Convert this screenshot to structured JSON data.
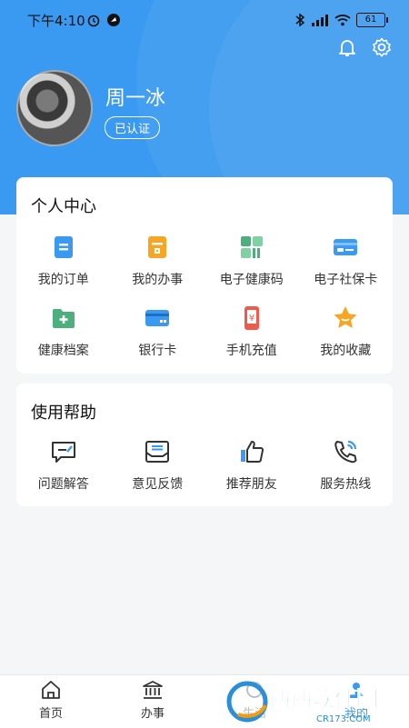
{
  "status_bar": {
    "time": "下午4:10",
    "battery": "61"
  },
  "profile": {
    "name": "周一冰",
    "badge": "已认证"
  },
  "personal_center": {
    "title": "个人中心",
    "items": [
      {
        "label": "我的订单",
        "icon": "order-icon",
        "color": "#3a99f0"
      },
      {
        "label": "我的办事",
        "icon": "affairs-icon",
        "color": "#f5a623"
      },
      {
        "label": "电子健康码",
        "icon": "health-code-icon",
        "color": "#4caf7d"
      },
      {
        "label": "电子社保卡",
        "icon": "social-card-icon",
        "color": "#3a99f0"
      },
      {
        "label": "健康档案",
        "icon": "health-record-icon",
        "color": "#4caf7d"
      },
      {
        "label": "银行卡",
        "icon": "bank-card-icon",
        "color": "#3a99f0"
      },
      {
        "label": "手机充值",
        "icon": "phone-recharge-icon",
        "color": "#f05a4a"
      },
      {
        "label": "我的收藏",
        "icon": "favorite-icon",
        "color": "#f5a623"
      }
    ]
  },
  "help": {
    "title": "使用帮助",
    "items": [
      {
        "label": "问题解答",
        "icon": "qa-icon"
      },
      {
        "label": "意见反馈",
        "icon": "feedback-icon"
      },
      {
        "label": "推荐朋友",
        "icon": "thumbs-up-icon"
      },
      {
        "label": "服务热线",
        "icon": "hotline-icon"
      }
    ]
  },
  "bottom_nav": {
    "items": [
      {
        "label": "首页",
        "icon": "home-icon"
      },
      {
        "label": "办事",
        "icon": "government-icon"
      },
      {
        "label": "生活",
        "icon": "life-icon"
      },
      {
        "label": "我的",
        "icon": "profile-icon"
      }
    ]
  },
  "watermark": {
    "text": "西西软件园",
    "url_text": "CR173.COM"
  }
}
